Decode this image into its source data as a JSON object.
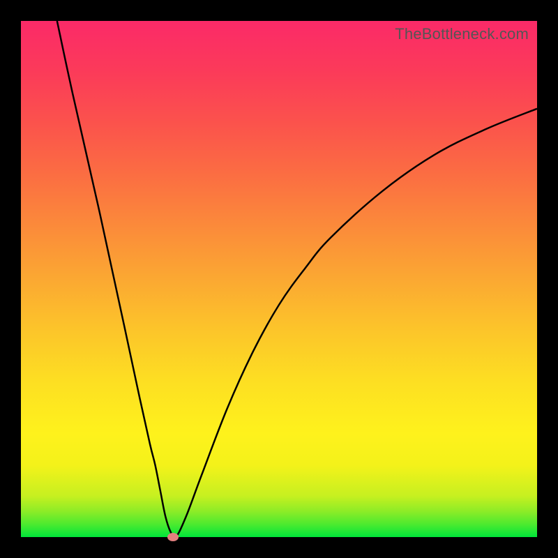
{
  "watermark": "TheBottleneck.com",
  "chart_data": {
    "type": "line",
    "title": "",
    "xlabel": "",
    "ylabel": "",
    "xlim": [
      0,
      100
    ],
    "ylim": [
      0,
      100
    ],
    "grid": false,
    "series": [
      {
        "name": "curve",
        "x": [
          7,
          10,
          15,
          20,
          23,
          25,
          26,
          27,
          28,
          29,
          30,
          32,
          35,
          40,
          45,
          50,
          55,
          60,
          70,
          80,
          90,
          100
        ],
        "y": [
          100,
          86,
          64,
          41,
          27,
          18,
          14,
          9,
          4,
          1,
          0,
          4,
          12,
          25,
          36,
          45,
          52,
          58,
          67,
          74,
          79,
          83
        ]
      }
    ],
    "marker": {
      "x": 29.5,
      "y": 0,
      "color": "#e48080"
    },
    "gradient_stops": [
      {
        "pos": 0,
        "color": "#00e63a"
      },
      {
        "pos": 20,
        "color": "#fef21c"
      },
      {
        "pos": 50,
        "color": "#fba832"
      },
      {
        "pos": 100,
        "color": "#fb2a68"
      }
    ]
  }
}
